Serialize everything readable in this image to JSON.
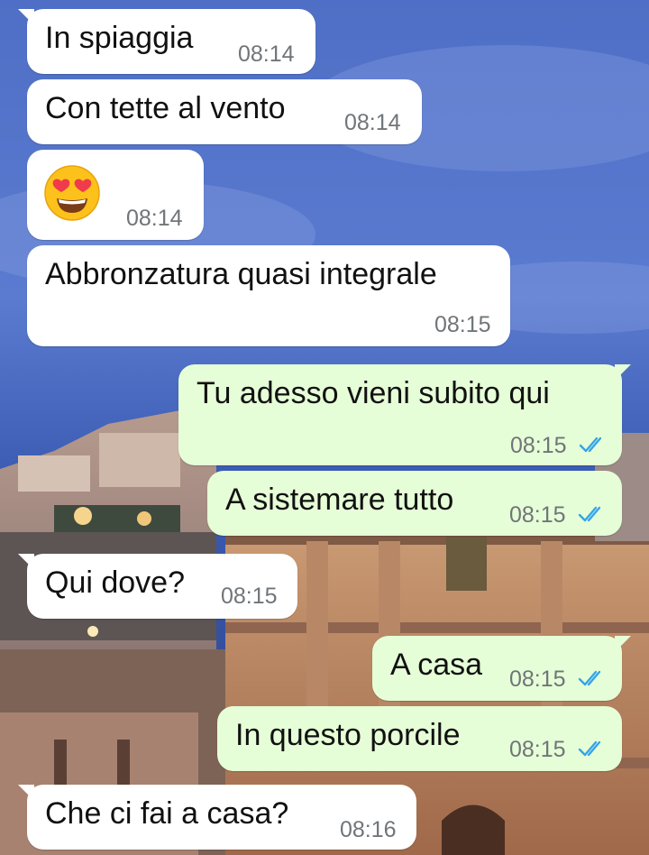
{
  "colors": {
    "incoming_bubble": "#ffffff",
    "outgoing_bubble": "#e6fed7",
    "timestamp": "#707579",
    "read_ticks": "#35a4e8"
  },
  "messages": [
    {
      "direction": "incoming",
      "text": "In spiaggia",
      "time": "08:14"
    },
    {
      "direction": "incoming",
      "text": "Con tette al vento",
      "time": "08:14"
    },
    {
      "direction": "incoming",
      "emoji": "smiling-face-with-heart-eyes",
      "time": "08:14"
    },
    {
      "direction": "incoming",
      "text": "Abbronzatura quasi integrale",
      "time": "08:15"
    },
    {
      "direction": "outgoing",
      "text": "Tu adesso vieni subito qui",
      "time": "08:15",
      "status": "read"
    },
    {
      "direction": "outgoing",
      "text": "A sistemare tutto",
      "time": "08:15",
      "status": "read"
    },
    {
      "direction": "incoming",
      "text": "Qui dove?",
      "time": "08:15"
    },
    {
      "direction": "outgoing",
      "text": "A casa",
      "time": "08:15",
      "status": "read"
    },
    {
      "direction": "outgoing",
      "text": "In questo porcile",
      "time": "08:15",
      "status": "read"
    },
    {
      "direction": "incoming",
      "text": "Che ci fai a casa?",
      "time": "08:16"
    }
  ]
}
